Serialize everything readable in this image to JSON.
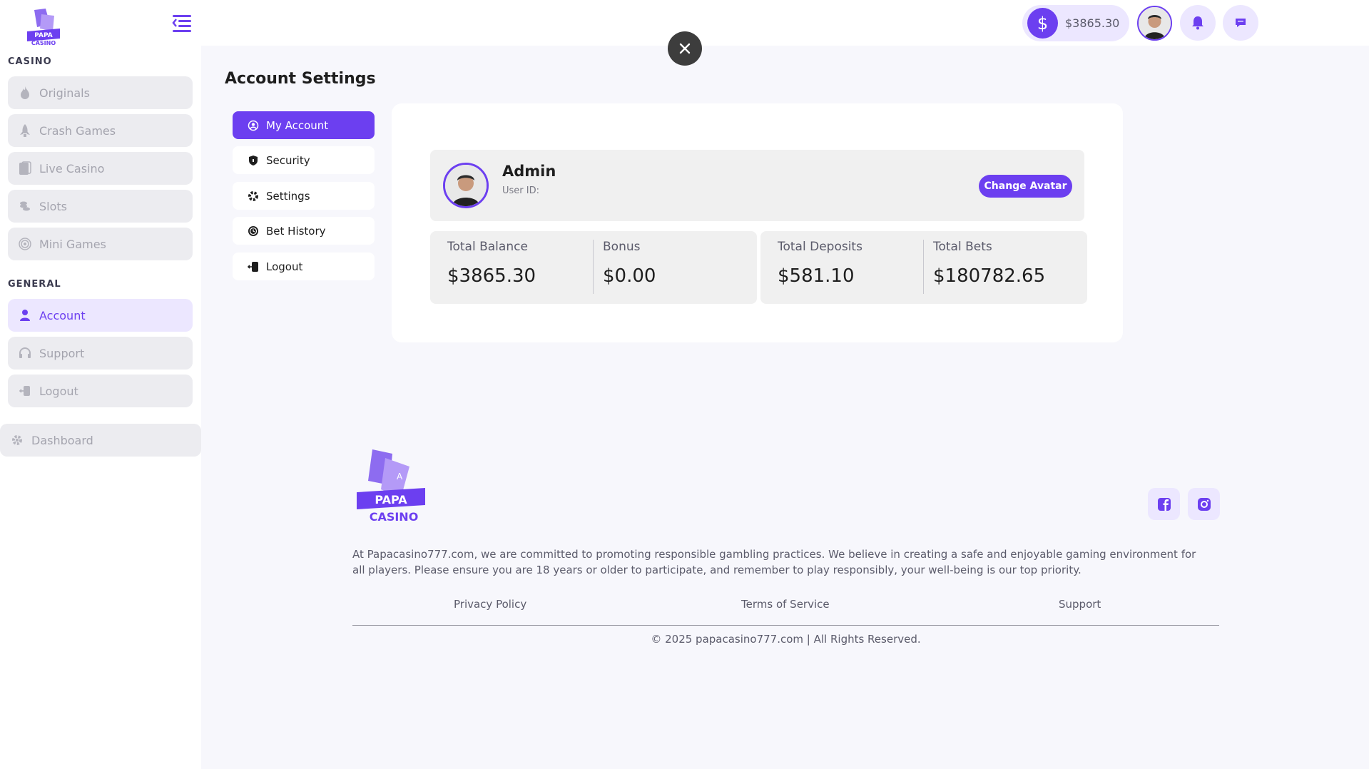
{
  "brand": {
    "logo_line1": "PAPA",
    "logo_line2": "CASINO",
    "accent_color": "#6c3ff0"
  },
  "sidebar": {
    "casino_title": "CASINO",
    "casino_items": [
      {
        "label": "Originals",
        "icon": "flame-icon"
      },
      {
        "label": "Crash Games",
        "icon": "rocket-icon"
      },
      {
        "label": "Live Casino",
        "icon": "cards-icon"
      },
      {
        "label": "Slots",
        "icon": "coins-icon"
      },
      {
        "label": "Mini Games",
        "icon": "target-icon"
      }
    ],
    "general_title": "GENERAL",
    "general_items": [
      {
        "label": "Account",
        "icon": "user-icon",
        "active": true
      },
      {
        "label": "Support",
        "icon": "headset-icon"
      },
      {
        "label": "Logout",
        "icon": "logout-icon"
      }
    ],
    "dashboard_label": "Dashboard"
  },
  "header": {
    "balance": "$3865.30",
    "dollar_symbol": "$"
  },
  "main": {
    "page_title": "Account Settings",
    "tabs": [
      {
        "label": "My Account",
        "icon": "user-circle-icon",
        "active": true
      },
      {
        "label": "Security",
        "icon": "shield-icon"
      },
      {
        "label": "Settings",
        "icon": "gear-icon"
      },
      {
        "label": "Bet History",
        "icon": "history-icon"
      },
      {
        "label": "Logout",
        "icon": "logout-icon"
      }
    ],
    "profile": {
      "name": "Admin",
      "user_id_label": "User ID:",
      "change_avatar_label": "Change Avatar"
    },
    "stats": [
      {
        "label": "Total Balance",
        "value": "$3865.30"
      },
      {
        "label": "Bonus",
        "value": "$0.00"
      },
      {
        "label": "Total Deposits",
        "value": "$581.10"
      },
      {
        "label": "Total Bets",
        "value": "$180782.65"
      }
    ]
  },
  "footer": {
    "disclaimer": "At Papacasino777.com, we are committed to promoting responsible gambling practices. We believe in creating a safe and enjoyable gaming environment for all players. Please ensure you are 18 years or older to participate, and remember to play responsibly, your well-being is our top priority.",
    "links": [
      "Privacy Policy",
      "Terms of Service",
      "Support"
    ],
    "copyright": "© 2025 papacasino777.com | All Rights Reserved.",
    "socials": [
      "facebook-icon",
      "instagram-icon"
    ]
  }
}
